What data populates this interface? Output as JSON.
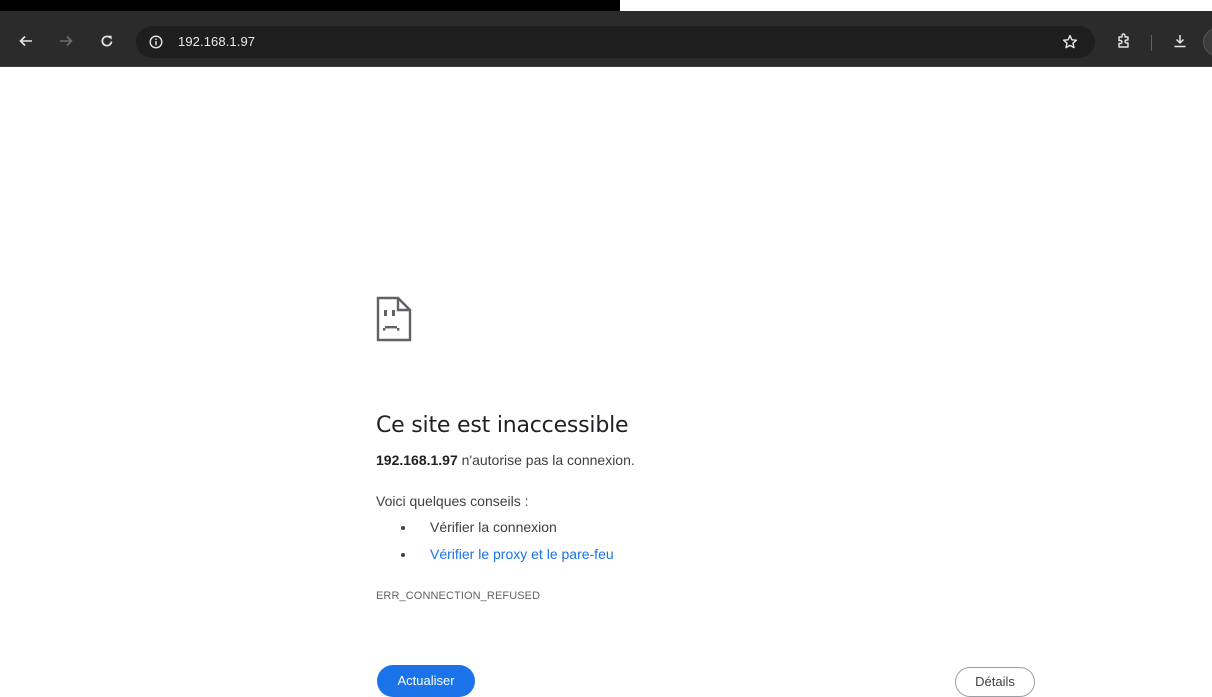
{
  "browser": {
    "url": "192.168.1.97",
    "nav": {
      "back": "back-arrow",
      "forward": "forward-arrow",
      "reload": "reload"
    }
  },
  "error_page": {
    "title": "Ce site est inaccessible",
    "host": "192.168.1.97",
    "message_rest": " n'autorise pas la connexion.",
    "tips_heading": "Voici quelques conseils :",
    "tips": [
      {
        "label": "Vérifier la connexion",
        "link": false
      },
      {
        "label": "Vérifier le proxy et le pare-feu",
        "link": true
      }
    ],
    "error_code": "ERR_CONNECTION_REFUSED",
    "reload_button": "Actualiser",
    "details_button": "Détails"
  },
  "colors": {
    "toolbar": "#2b2b2b",
    "omnibox": "#1e1e1e",
    "link": "#1a73e8",
    "primary_button": "#1a73e8"
  }
}
